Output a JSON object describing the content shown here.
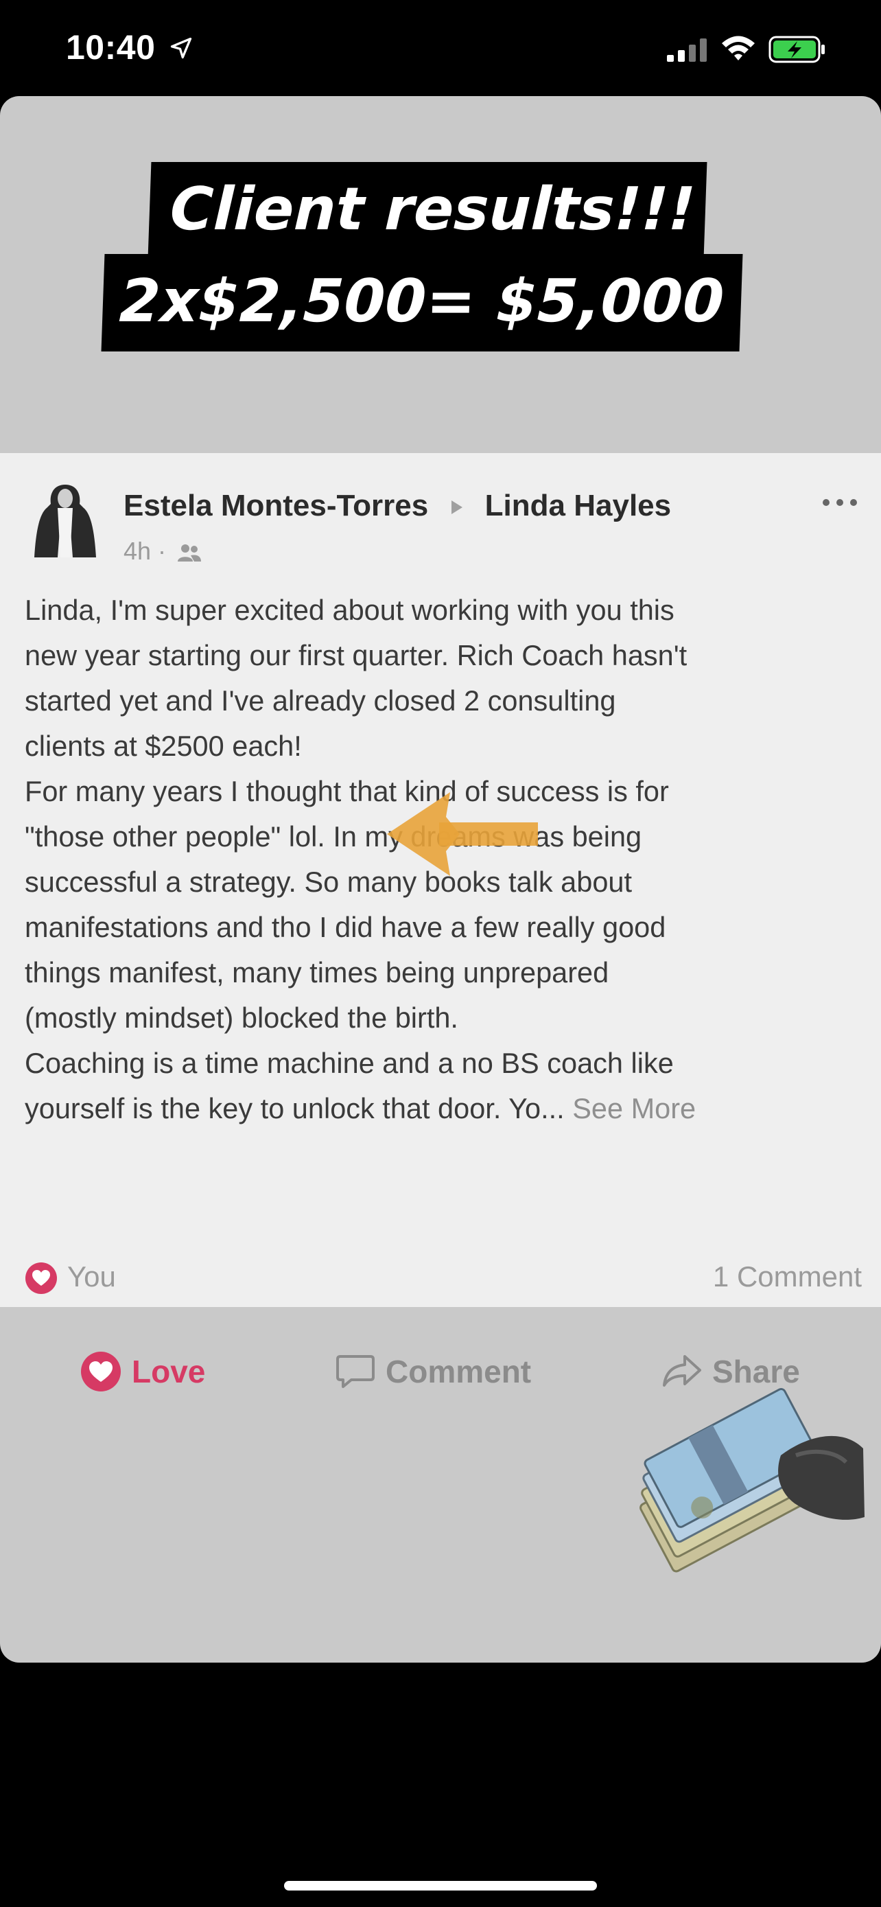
{
  "status_bar": {
    "time": "10:40",
    "icons": [
      "location-arrow-icon",
      "signal-icon",
      "wifi-icon",
      "battery-charging-icon"
    ]
  },
  "headline": {
    "line1": "Client results!!!",
    "line2": "2x$2,500= $5,000"
  },
  "post": {
    "author": "Estela Montes-Torres",
    "recipient": "Linda Hayles",
    "time": "4h",
    "audience_icon": "friends-icon",
    "body_lines": [
      "Linda, I'm super excited about working with you this",
      "new year starting our first quarter. Rich Coach hasn't",
      "started yet and I've already closed 2 consulting",
      "clients at $2500 each!",
      "For many years I thought that kind of success is for",
      "\"those other people\" lol. In my dreams was being",
      "successful a strategy. So many books talk about",
      "manifestations and tho I did have a few really good",
      "things manifest, many times being unprepared",
      "(mostly mindset) blocked the birth.",
      "Coaching is a time machine and a no BS coach like"
    ],
    "last_line": "yourself is the key to unlock that door. Yo...",
    "see_more": "See More",
    "reaction_by": "You",
    "comment_count": "1 Comment"
  },
  "actions": {
    "love": "Love",
    "comment": "Comment",
    "share": "Share"
  },
  "colors": {
    "love_accent": "#d63a64",
    "arrow": "#e8a33a",
    "card_bg": "#c9c9c9",
    "post_bg": "#efefef"
  }
}
